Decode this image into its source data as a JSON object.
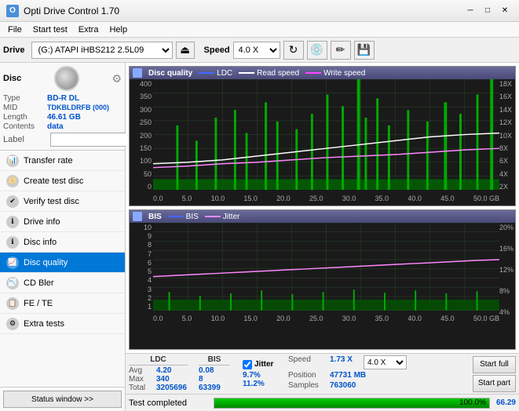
{
  "titlebar": {
    "title": "Opti Drive Control 1.70",
    "minimize": "─",
    "maximize": "□",
    "close": "✕"
  },
  "menubar": {
    "items": [
      "File",
      "Start test",
      "Extra",
      "Help"
    ]
  },
  "toolbar": {
    "drive_label": "Drive",
    "drive_value": "(G:)  ATAPI iHBS212  2.5L09",
    "speed_label": "Speed",
    "speed_value": "4.0 X"
  },
  "disc": {
    "title": "Disc",
    "type_label": "Type",
    "type_value": "BD-R DL",
    "mid_label": "MID",
    "mid_value": "TDKBLDRFB (000)",
    "length_label": "Length",
    "length_value": "46.61 GB",
    "contents_label": "Contents",
    "contents_value": "data",
    "label_label": "Label",
    "label_value": ""
  },
  "nav": {
    "items": [
      {
        "id": "transfer-rate",
        "label": "Transfer rate",
        "active": false
      },
      {
        "id": "create-test-disc",
        "label": "Create test disc",
        "active": false
      },
      {
        "id": "verify-test-disc",
        "label": "Verify test disc",
        "active": false
      },
      {
        "id": "drive-info",
        "label": "Drive info",
        "active": false
      },
      {
        "id": "disc-info",
        "label": "Disc info",
        "active": false
      },
      {
        "id": "disc-quality",
        "label": "Disc quality",
        "active": true
      },
      {
        "id": "cd-bler",
        "label": "CD Bler",
        "active": false
      },
      {
        "id": "fe-te",
        "label": "FE / TE",
        "active": false
      },
      {
        "id": "extra-tests",
        "label": "Extra tests",
        "active": false
      }
    ],
    "status_window_btn": "Status window >>"
  },
  "chart1": {
    "title": "Disc quality",
    "legend": {
      "ldc": "LDC",
      "read_speed": "Read speed",
      "write_speed": "Write speed"
    },
    "y_labels_left": [
      "400",
      "350",
      "300",
      "250",
      "200",
      "150",
      "100",
      "50",
      "0"
    ],
    "y_labels_right": [
      "18X",
      "16X",
      "14X",
      "12X",
      "10X",
      "8X",
      "6X",
      "4X",
      "2X"
    ],
    "x_labels": [
      "0.0",
      "5.0",
      "10.0",
      "15.0",
      "20.0",
      "25.0",
      "30.0",
      "35.0",
      "40.0",
      "45.0",
      "50.0 GB"
    ]
  },
  "chart2": {
    "title": "BIS",
    "legend": {
      "bis": "BIS",
      "jitter": "Jitter"
    },
    "y_labels_left": [
      "10",
      "9",
      "8",
      "7",
      "6",
      "5",
      "4",
      "3",
      "2",
      "1"
    ],
    "y_labels_right": [
      "20%",
      "16%",
      "12%",
      "8%",
      "4%"
    ],
    "x_labels": [
      "0.0",
      "5.0",
      "10.0",
      "15.0",
      "20.0",
      "25.0",
      "30.0",
      "35.0",
      "40.0",
      "45.0",
      "50.0 GB"
    ]
  },
  "stats": {
    "headers": [
      "LDC",
      "BIS",
      "",
      "Jitter",
      "Speed",
      ""
    ],
    "avg_label": "Avg",
    "max_label": "Max",
    "total_label": "Total",
    "ldc_avg": "4.20",
    "ldc_max": "340",
    "ldc_total": "3205696",
    "bis_avg": "0.08",
    "bis_max": "8",
    "bis_total": "63399",
    "jitter_avg": "9.7%",
    "jitter_max": "11.2%",
    "jitter_checkbox": "Jitter",
    "speed_label": "Speed",
    "speed_value": "1.73 X",
    "speed_select": "4.0 X",
    "position_label": "Position",
    "position_value": "47731 MB",
    "samples_label": "Samples",
    "samples_value": "763060",
    "start_full_btn": "Start full",
    "start_part_btn": "Start part"
  },
  "statusbar": {
    "text": "Test completed",
    "progress": "100.0%",
    "progress_value": 100,
    "speed": "66.29"
  }
}
